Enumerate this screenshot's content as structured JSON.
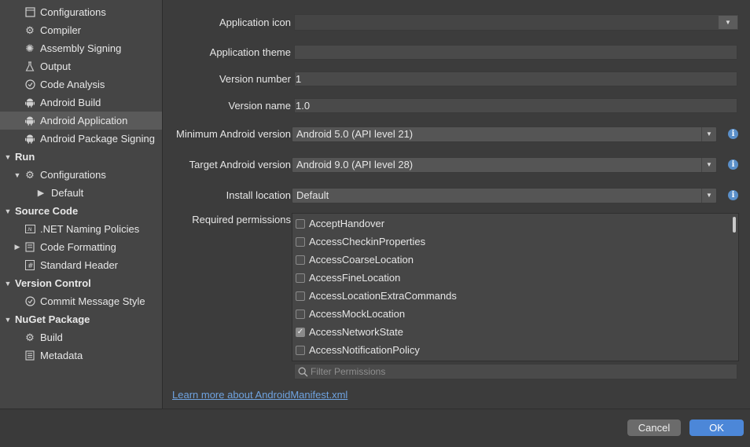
{
  "sidebar": {
    "items": [
      {
        "label": "Configurations",
        "icon": "window-icon",
        "indent": 1,
        "section": false,
        "selected": false,
        "expander": ""
      },
      {
        "label": "Compiler",
        "icon": "gear-icon",
        "indent": 1,
        "section": false,
        "selected": false,
        "expander": ""
      },
      {
        "label": "Assembly Signing",
        "icon": "seal-icon",
        "indent": 1,
        "section": false,
        "selected": false,
        "expander": ""
      },
      {
        "label": "Output",
        "icon": "flask-icon",
        "indent": 1,
        "section": false,
        "selected": false,
        "expander": ""
      },
      {
        "label": "Code Analysis",
        "icon": "circle-check-icon",
        "indent": 1,
        "section": false,
        "selected": false,
        "expander": ""
      },
      {
        "label": "Android Build",
        "icon": "android-icon",
        "indent": 1,
        "section": false,
        "selected": false,
        "expander": ""
      },
      {
        "label": "Android Application",
        "icon": "android-icon",
        "indent": 1,
        "section": false,
        "selected": true,
        "expander": ""
      },
      {
        "label": "Android Package Signing",
        "icon": "android-icon",
        "indent": 1,
        "section": false,
        "selected": false,
        "expander": ""
      },
      {
        "label": "Run",
        "icon": "",
        "indent": 0,
        "section": true,
        "selected": false,
        "expander": "▼"
      },
      {
        "label": "Configurations",
        "icon": "gear-icon",
        "indent": 1,
        "section": false,
        "selected": false,
        "expander": "▼"
      },
      {
        "label": "Default",
        "icon": "play-icon",
        "indent": 2,
        "section": false,
        "selected": false,
        "expander": ""
      },
      {
        "label": "Source Code",
        "icon": "",
        "indent": 0,
        "section": true,
        "selected": false,
        "expander": "▼"
      },
      {
        "label": ".NET Naming Policies",
        "icon": "naming-icon",
        "indent": 1,
        "section": false,
        "selected": false,
        "expander": ""
      },
      {
        "label": "Code Formatting",
        "icon": "document-icon",
        "indent": 1,
        "section": false,
        "selected": false,
        "expander": "▶"
      },
      {
        "label": "Standard Header",
        "icon": "hash-icon",
        "indent": 1,
        "section": false,
        "selected": false,
        "expander": ""
      },
      {
        "label": "Version Control",
        "icon": "",
        "indent": 0,
        "section": true,
        "selected": false,
        "expander": "▼"
      },
      {
        "label": "Commit Message Style",
        "icon": "circle-check-icon",
        "indent": 1,
        "section": false,
        "selected": false,
        "expander": ""
      },
      {
        "label": "NuGet Package",
        "icon": "",
        "indent": 0,
        "section": true,
        "selected": false,
        "expander": "▼"
      },
      {
        "label": "Build",
        "icon": "gear-icon",
        "indent": 1,
        "section": false,
        "selected": false,
        "expander": ""
      },
      {
        "label": "Metadata",
        "icon": "list-icon",
        "indent": 1,
        "section": false,
        "selected": false,
        "expander": ""
      }
    ]
  },
  "form": {
    "app_icon_label": "Application icon",
    "app_icon_value": "",
    "app_theme_label": "Application theme",
    "app_theme_value": "",
    "version_number_label": "Version number",
    "version_number_value": "1",
    "version_name_label": "Version name",
    "version_name_value": "1.0",
    "min_android_label": "Minimum Android version",
    "min_android_value": "Android 5.0 (API level 21)",
    "target_android_label": "Target Android version",
    "target_android_value": "Android 9.0 (API level 28)",
    "install_location_label": "Install location",
    "install_location_value": "Default",
    "required_permissions_label": "Required permissions"
  },
  "permissions": [
    {
      "name": "AcceptHandover",
      "checked": false
    },
    {
      "name": "AccessCheckinProperties",
      "checked": false
    },
    {
      "name": "AccessCoarseLocation",
      "checked": false
    },
    {
      "name": "AccessFineLocation",
      "checked": false
    },
    {
      "name": "AccessLocationExtraCommands",
      "checked": false
    },
    {
      "name": "AccessMockLocation",
      "checked": false
    },
    {
      "name": "AccessNetworkState",
      "checked": true
    },
    {
      "name": "AccessNotificationPolicy",
      "checked": false
    }
  ],
  "filter": {
    "placeholder": "Filter Permissions"
  },
  "learn_more_link": "Learn more about AndroidManifest.xml",
  "buttons": {
    "cancel": "Cancel",
    "ok": "OK"
  },
  "colors": {
    "accent": "#4c87d8",
    "link": "#6fa3e0",
    "info": "#5a8fc9"
  }
}
